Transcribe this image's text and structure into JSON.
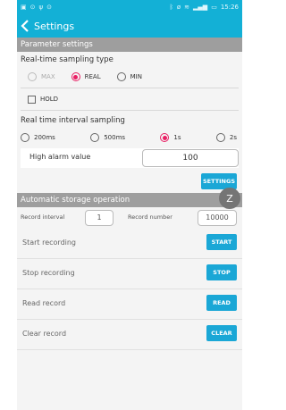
{
  "statusbar": {
    "left_icons": [
      "gallery-icon",
      "sync-icon",
      "usb-icon",
      "android-icon"
    ],
    "right_icons": [
      "bluetooth-icon",
      "mute-icon",
      "wifi-icon",
      "signal-icon",
      "battery-icon"
    ],
    "time": "15:26"
  },
  "appbar": {
    "title": "Settings"
  },
  "parameter": {
    "header": "Parameter settings",
    "sampling_type_label": "Real-time sampling type",
    "sampling_options": [
      "MAX",
      "REAL",
      "MIN"
    ],
    "sampling_selected": "REAL",
    "hold_label": "HOLD",
    "interval_label": "Real time interval sampling",
    "interval_options": [
      "200ms",
      "500ms",
      "1s",
      "2s"
    ],
    "interval_selected": "1s",
    "alarm_label": "High alarm value",
    "alarm_value": "100",
    "settings_button": "SETTINGS"
  },
  "operation": {
    "header": "Automatic storage operation",
    "fab_label": "Z",
    "record_interval_label": "Record interval",
    "record_interval_value": "1",
    "record_number_label": "Record number",
    "record_number_value": "10000",
    "rows": [
      {
        "label": "Start recording",
        "button": "START"
      },
      {
        "label": "Stop recording",
        "button": "STOP"
      },
      {
        "label": "Read record",
        "button": "READ"
      },
      {
        "label": "Clear record",
        "button": "CLEAR"
      }
    ]
  },
  "colors": {
    "accent": "#13b0d6",
    "button": "#1aa7d6",
    "radio_selected": "#e91e63",
    "header": "#9e9e9e"
  }
}
